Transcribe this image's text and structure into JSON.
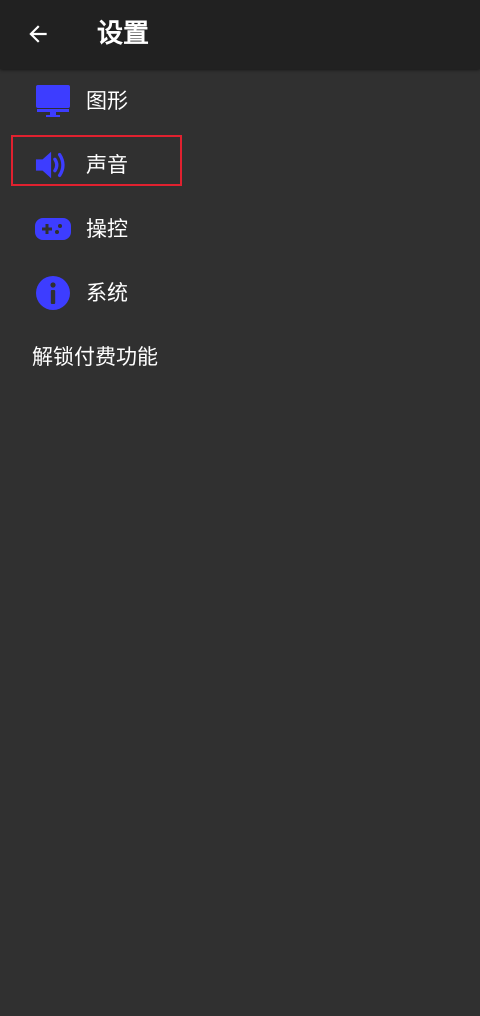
{
  "header": {
    "title": "设置",
    "back_icon": "arrow-left-icon"
  },
  "menu": {
    "items": [
      {
        "label": "图形",
        "icon": "monitor-icon"
      },
      {
        "label": "声音",
        "icon": "speaker-icon"
      },
      {
        "label": "操控",
        "icon": "gamepad-icon"
      },
      {
        "label": "系统",
        "icon": "info-icon"
      },
      {
        "label": "解锁付费功能"
      }
    ]
  },
  "colors": {
    "icon_accent": "#3d3dff",
    "background": "#303030",
    "appbar": "#212121",
    "highlight_border": "#e0212f"
  }
}
